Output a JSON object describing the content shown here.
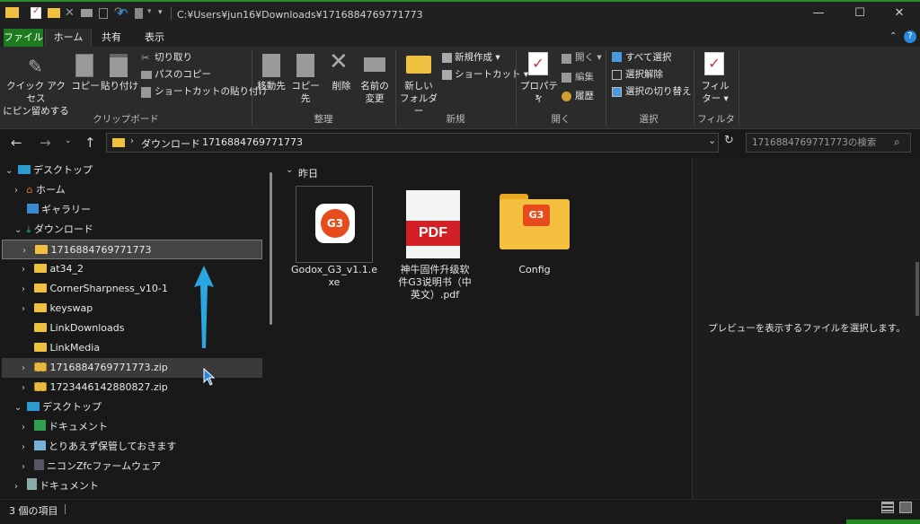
{
  "window": {
    "path": "C:¥Users¥jun16¥Downloads¥1716884769771773",
    "minimize": "—",
    "maximize": "☐",
    "close": "✕"
  },
  "tabs": [
    "ファイル",
    "ホーム",
    "共有",
    "表示"
  ],
  "ribbon": {
    "clipboard": {
      "pin_label1": "クイック アクセス",
      "pin_label2": "にピン留めする",
      "copy": "コピー",
      "paste": "貼り付け",
      "cut": "切り取り",
      "copy_path": "パスのコピー",
      "paste_shortcut": "ショートカットの貼り付け",
      "group": "クリップボード"
    },
    "organize": {
      "move_to": "移動先",
      "copy_to": "コピー先",
      "delete": "削除",
      "rename1": "名前の",
      "rename2": "変更",
      "group": "整理"
    },
    "new": {
      "new_folder1": "新しい",
      "new_folder2": "フォルダー",
      "new_item": "新規作成",
      "shortcut": "ショートカット",
      "group": "新規"
    },
    "open": {
      "properties": "プロパティ",
      "open": "開く",
      "edit": "編集",
      "history": "履歴",
      "group": "開く"
    },
    "select": {
      "select_all": "すべて選択",
      "select_none": "選択解除",
      "invert": "選択の切り替え",
      "group": "選択"
    },
    "filter": {
      "filter1": "フィル",
      "filter2": "ター",
      "group": "フィルター"
    }
  },
  "nav": {
    "breadcrumb": [
      "ダウンロード",
      "1716884769771773"
    ],
    "search_placeholder": "1716884769771773の検索"
  },
  "tree": [
    {
      "label": "デスクトップ"
    },
    {
      "label": "ホーム"
    },
    {
      "label": "ギャラリー"
    },
    {
      "label": "ダウンロード"
    },
    {
      "label": "1716884769771773"
    },
    {
      "label": "at34_2"
    },
    {
      "label": "CornerSharpness_v10-1"
    },
    {
      "label": "keyswap"
    },
    {
      "label": "LinkDownloads"
    },
    {
      "label": "LinkMedia"
    },
    {
      "label": "1716884769771773.zip"
    },
    {
      "label": "1723446142880827.zip"
    },
    {
      "label": "デスクトップ"
    },
    {
      "label": "ドキュメント"
    },
    {
      "label": "とりあえず保管しておきます"
    },
    {
      "label": "ニコンZfcファームウェア"
    },
    {
      "label": "ドキュメント"
    }
  ],
  "content": {
    "group_header": "昨日",
    "files": [
      {
        "name1": "Godox_G3_v1.1.e",
        "name2": "xe",
        "name3": ""
      },
      {
        "name1": "神牛固件升级软",
        "name2": "件G3说明书（中",
        "name3": "英文）.pdf"
      },
      {
        "name1": "Config",
        "name2": "",
        "name3": ""
      }
    ],
    "pdf_badge": "PDF",
    "app_badge": "G3"
  },
  "preview": {
    "message": "プレビューを表示するファイルを選択します。"
  },
  "status": {
    "items": "3 個の項目"
  },
  "colors": {
    "file_tab": "#1e7a1e",
    "arrow": "#2aa6e0",
    "folder": "#f0c040"
  }
}
